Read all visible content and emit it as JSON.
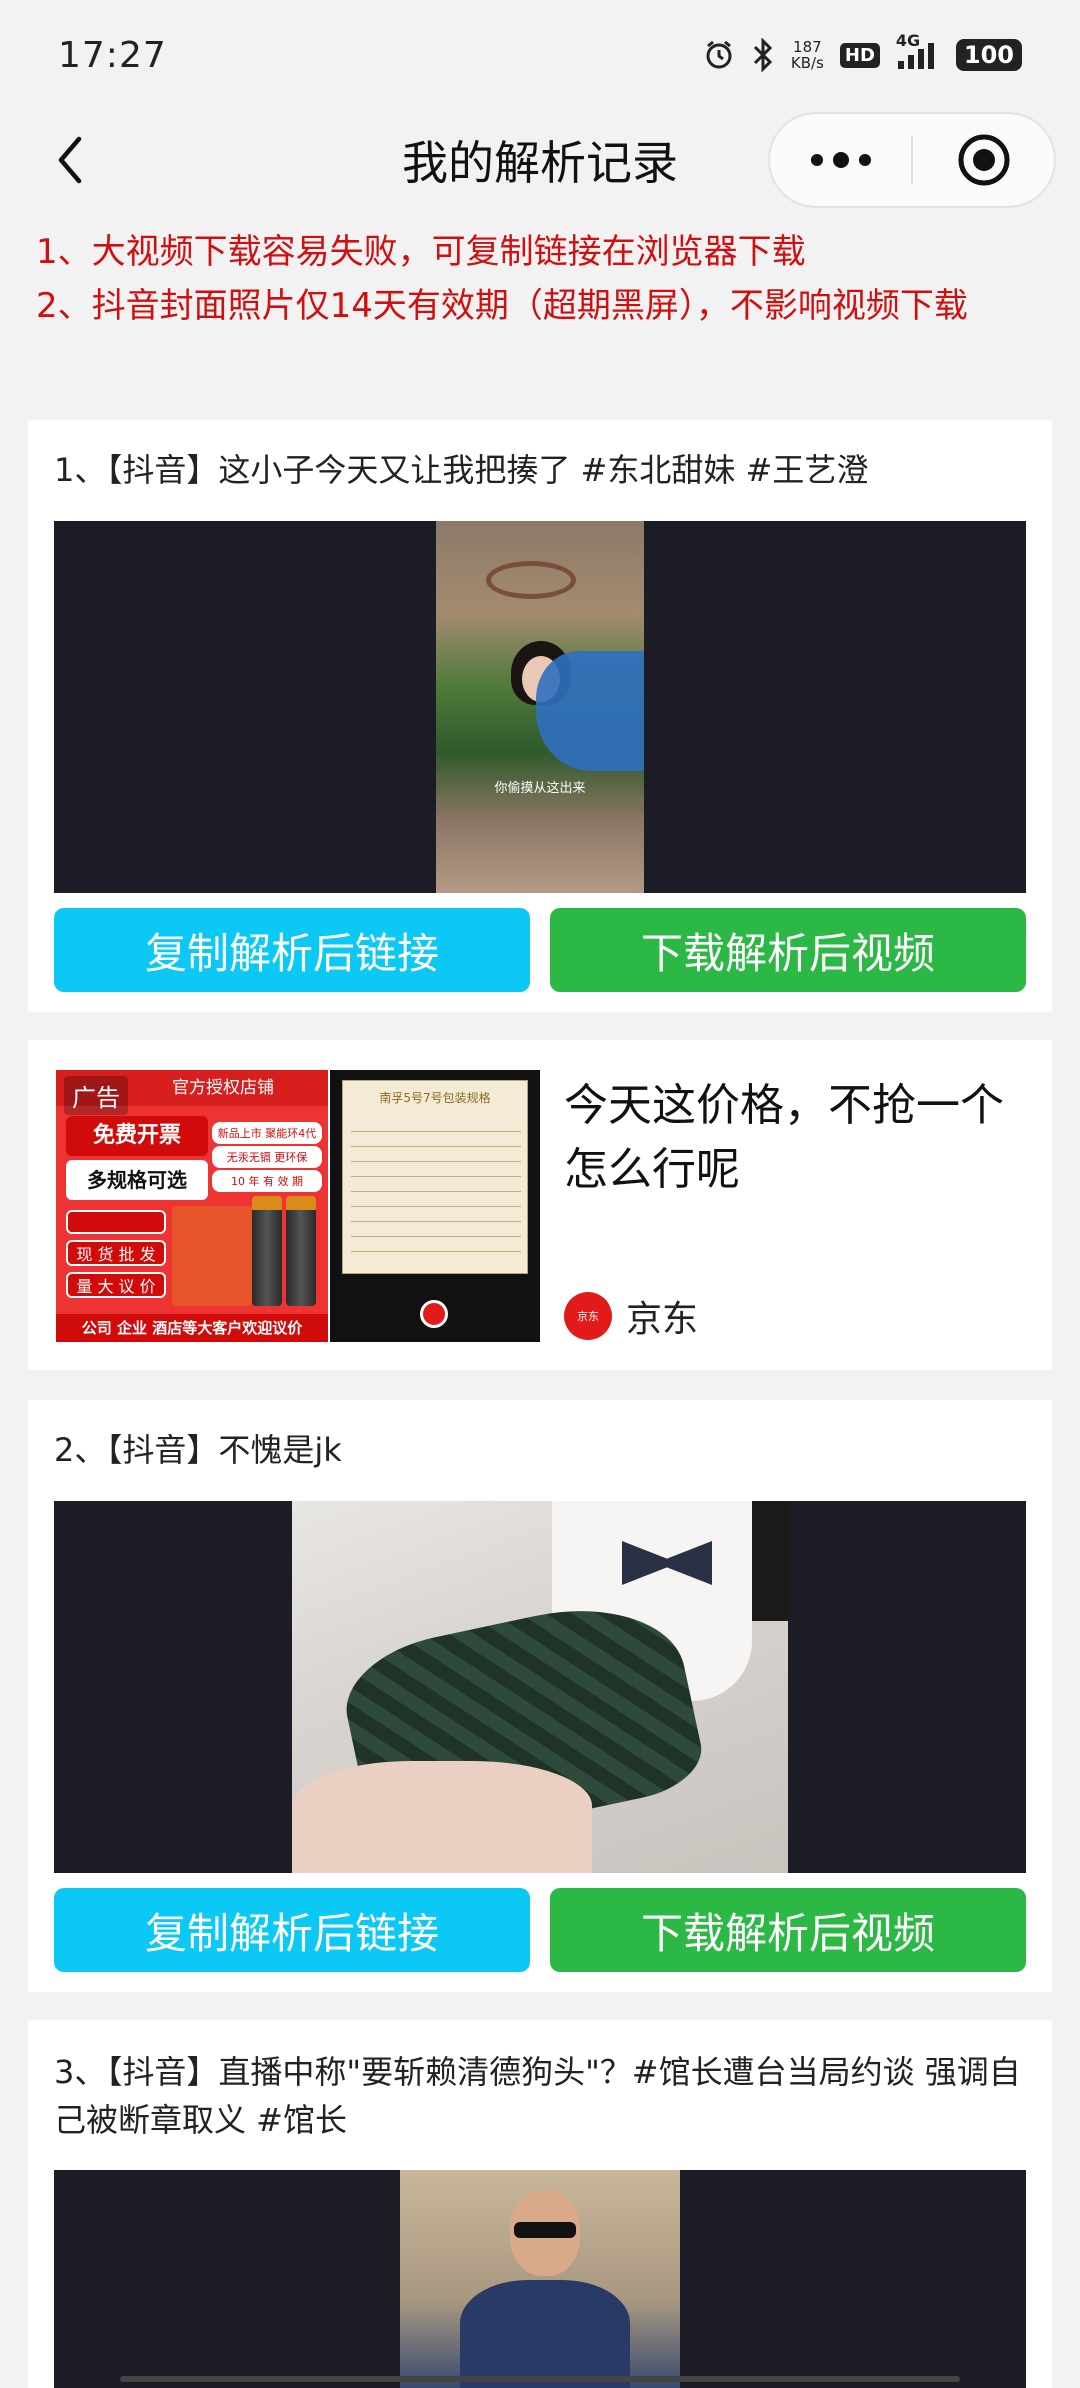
{
  "status": {
    "time": "17:27",
    "net_speed_value": "187",
    "net_speed_unit": "KB/s",
    "hd": "HD",
    "network": "4G",
    "battery": "100"
  },
  "nav": {
    "title": "我的解析记录",
    "more_icon": "more-dots-icon",
    "close_icon": "target-circle-icon"
  },
  "notice": {
    "line1": "1、大视频下载容易失败，可复制链接在浏览器下载",
    "line2": "2、抖音封面照片仅14天有效期（超期黑屏），不影响视频下载"
  },
  "records": [
    {
      "title": "1、【抖音】这小子今天又让我把揍了 #东北甜妹 #王艺澄",
      "caption": "你偷摸从这出来",
      "copy_label": "复制解析后链接",
      "download_label": "下载解析后视频"
    },
    {
      "title": "2、【抖音】不愧是jk",
      "copy_label": "复制解析后链接",
      "download_label": "下载解析后视频"
    },
    {
      "title": "3、【抖音】直播中称\"要斩赖清德狗头\"？#馆长遭台当局约谈 强调自己被断章取义 #馆长"
    }
  ],
  "ad": {
    "label": "广告",
    "headline": "今天这价格，不抢一个怎么行呢",
    "brand": "京东",
    "brand_logo_text": "京东",
    "img1": {
      "store": "官方授权店铺",
      "free_invoice": "免费开票",
      "multi_spec": "多规格可选",
      "new_tag1": "新品上市 聚能环4代",
      "new_tag2": "无汞无镉 更环保",
      "shelf_life": "10 年 有 效 期",
      "wholesale": "现 货 批 发",
      "bulk_price": "量 大 议 价",
      "footer": "公司 企业 酒店等大客户欢迎议价"
    },
    "img2": {
      "title": "南孚5号7号包装规格"
    }
  }
}
